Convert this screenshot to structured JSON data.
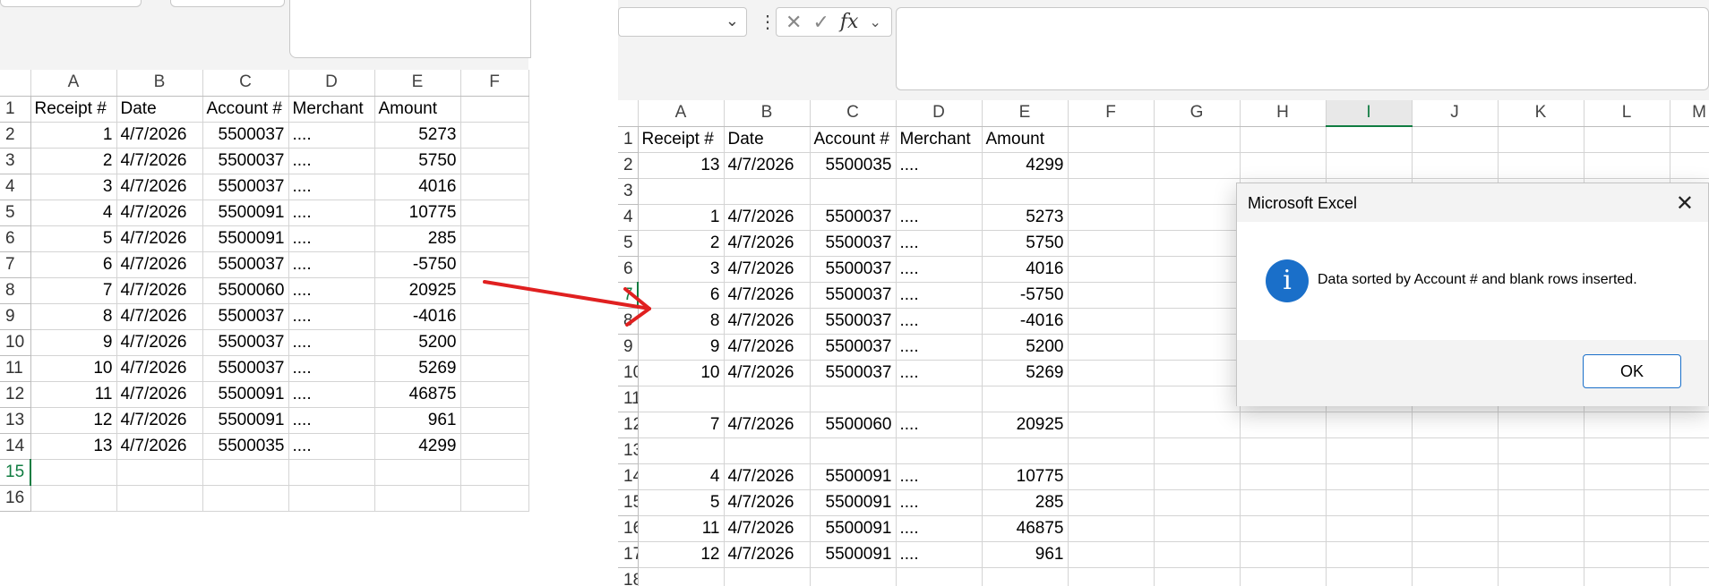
{
  "columns_left": [
    "A",
    "B",
    "C",
    "D",
    "E",
    "F"
  ],
  "columns_right": [
    "A",
    "B",
    "C",
    "D",
    "E",
    "F",
    "G",
    "H",
    "I",
    "J",
    "K",
    "L",
    "M"
  ],
  "left_sheet": {
    "rows": [
      {
        "row": "1",
        "a": "Receipt #",
        "b": "Date",
        "c": "Account #",
        "d": "Merchant",
        "e": "Amount"
      },
      {
        "row": "2",
        "a": "1",
        "b": "4/7/2026",
        "c": "5500037",
        "d": "....",
        "e": "5273"
      },
      {
        "row": "3",
        "a": "2",
        "b": "4/7/2026",
        "c": "5500037",
        "d": "....",
        "e": "5750"
      },
      {
        "row": "4",
        "a": "3",
        "b": "4/7/2026",
        "c": "5500037",
        "d": "....",
        "e": "4016"
      },
      {
        "row": "5",
        "a": "4",
        "b": "4/7/2026",
        "c": "5500091",
        "d": "....",
        "e": "10775"
      },
      {
        "row": "6",
        "a": "5",
        "b": "4/7/2026",
        "c": "5500091",
        "d": "....",
        "e": "285"
      },
      {
        "row": "7",
        "a": "6",
        "b": "4/7/2026",
        "c": "5500037",
        "d": "....",
        "e": "-5750"
      },
      {
        "row": "8",
        "a": "7",
        "b": "4/7/2026",
        "c": "5500060",
        "d": "....",
        "e": "20925"
      },
      {
        "row": "9",
        "a": "8",
        "b": "4/7/2026",
        "c": "5500037",
        "d": "....",
        "e": "-4016"
      },
      {
        "row": "10",
        "a": "9",
        "b": "4/7/2026",
        "c": "5500037",
        "d": "....",
        "e": "5200"
      },
      {
        "row": "11",
        "a": "10",
        "b": "4/7/2026",
        "c": "5500037",
        "d": "....",
        "e": "5269"
      },
      {
        "row": "12",
        "a": "11",
        "b": "4/7/2026",
        "c": "5500091",
        "d": "....",
        "e": "46875"
      },
      {
        "row": "13",
        "a": "12",
        "b": "4/7/2026",
        "c": "5500091",
        "d": "....",
        "e": "961"
      },
      {
        "row": "14",
        "a": "13",
        "b": "4/7/2026",
        "c": "5500035",
        "d": "....",
        "e": "4299"
      },
      {
        "row": "15",
        "a": "",
        "b": "",
        "c": "",
        "d": "",
        "e": ""
      },
      {
        "row": "16",
        "a": "",
        "b": "",
        "c": "",
        "d": "",
        "e": ""
      }
    ]
  },
  "right_sheet": {
    "rows": [
      {
        "row": "1",
        "a": "Receipt #",
        "b": "Date",
        "c": "Account #",
        "d": "Merchant",
        "e": "Amount"
      },
      {
        "row": "2",
        "a": "13",
        "b": "4/7/2026",
        "c": "5500035",
        "d": "....",
        "e": "4299"
      },
      {
        "row": "3",
        "a": "",
        "b": "",
        "c": "",
        "d": "",
        "e": ""
      },
      {
        "row": "4",
        "a": "1",
        "b": "4/7/2026",
        "c": "5500037",
        "d": "....",
        "e": "5273"
      },
      {
        "row": "5",
        "a": "2",
        "b": "4/7/2026",
        "c": "5500037",
        "d": "....",
        "e": "5750"
      },
      {
        "row": "6",
        "a": "3",
        "b": "4/7/2026",
        "c": "5500037",
        "d": "....",
        "e": "4016"
      },
      {
        "row": "7",
        "a": "6",
        "b": "4/7/2026",
        "c": "5500037",
        "d": "....",
        "e": "-5750"
      },
      {
        "row": "8",
        "a": "8",
        "b": "4/7/2026",
        "c": "5500037",
        "d": "....",
        "e": "-4016"
      },
      {
        "row": "9",
        "a": "9",
        "b": "4/7/2026",
        "c": "5500037",
        "d": "....",
        "e": "5200"
      },
      {
        "row": "10",
        "a": "10",
        "b": "4/7/2026",
        "c": "5500037",
        "d": "....",
        "e": "5269"
      },
      {
        "row": "11",
        "a": "",
        "b": "",
        "c": "",
        "d": "",
        "e": ""
      },
      {
        "row": "12",
        "a": "7",
        "b": "4/7/2026",
        "c": "5500060",
        "d": "....",
        "e": "20925"
      },
      {
        "row": "13",
        "a": "",
        "b": "",
        "c": "",
        "d": "",
        "e": ""
      },
      {
        "row": "14",
        "a": "4",
        "b": "4/7/2026",
        "c": "5500091",
        "d": "....",
        "e": "10775"
      },
      {
        "row": "15",
        "a": "5",
        "b": "4/7/2026",
        "c": "5500091",
        "d": "....",
        "e": "285"
      },
      {
        "row": "16",
        "a": "11",
        "b": "4/7/2026",
        "c": "5500091",
        "d": "....",
        "e": "46875"
      },
      {
        "row": "17",
        "a": "12",
        "b": "4/7/2026",
        "c": "5500091",
        "d": "....",
        "e": "961"
      },
      {
        "row": "18",
        "a": "",
        "b": "",
        "c": "",
        "d": "",
        "e": ""
      }
    ]
  },
  "formula": {
    "fx_label": "fx"
  },
  "dialog": {
    "title": "Microsoft Excel",
    "message": "Data sorted by Account # and blank rows inserted.",
    "ok_label": "OK",
    "icon": "info-icon"
  },
  "colors": {
    "arrow": "#e02020",
    "selection": "#107c41",
    "info": "#1a6fc9"
  }
}
